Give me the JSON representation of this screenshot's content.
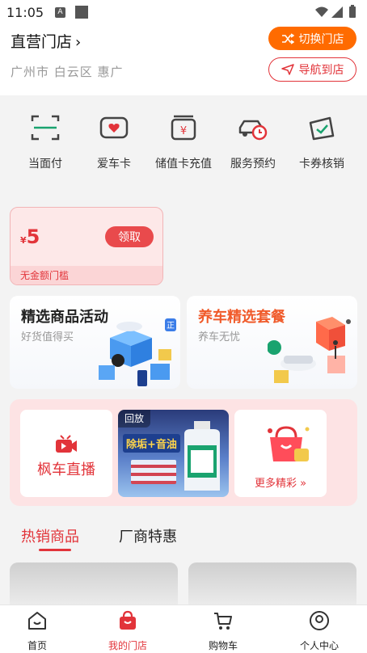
{
  "status_bar": {
    "time": "11:05",
    "a_label": "A"
  },
  "header": {
    "store_name": "直营门店",
    "switch_label": "切换门店",
    "address": "广州市 白云区 惠广",
    "navigate_label": "导航到店"
  },
  "quick_actions": [
    {
      "label": "当面付",
      "icon": "scan-icon"
    },
    {
      "label": "爱车卡",
      "icon": "car-card-icon"
    },
    {
      "label": "储值卡充值",
      "icon": "stored-value-icon"
    },
    {
      "label": "服务预约",
      "icon": "service-booking-icon"
    },
    {
      "label": "卡券核销",
      "icon": "coupon-verify-icon"
    }
  ],
  "coupon": {
    "currency": "¥",
    "amount": "5",
    "claim_label": "领取",
    "condition": "无金额门槛"
  },
  "promos": [
    {
      "title": "精选商品活动",
      "subtitle": "好货值得买",
      "title_color": "#222222"
    },
    {
      "title": "养车精选套餐",
      "subtitle": "养车无忧",
      "title_color": "#f05a2a"
    }
  ],
  "live": {
    "live_label": "枫车直播",
    "replay_tag": "回放",
    "replay_banner": "除垢+音油",
    "more_label": "更多精彩"
  },
  "tabs": [
    {
      "label": "热销商品",
      "active": true
    },
    {
      "label": "厂商特惠",
      "active": false
    }
  ],
  "bottom_nav": [
    {
      "label": "首页",
      "icon": "home-icon",
      "active": false
    },
    {
      "label": "我的门店",
      "icon": "store-bag-icon",
      "active": true
    },
    {
      "label": "购物车",
      "icon": "cart-icon",
      "active": false
    },
    {
      "label": "个人中心",
      "icon": "profile-icon",
      "active": false
    }
  ],
  "colors": {
    "brand_red": "#e2343a",
    "switch_orange": "#ff6b00",
    "coupon_bg": "#fde8e8"
  }
}
